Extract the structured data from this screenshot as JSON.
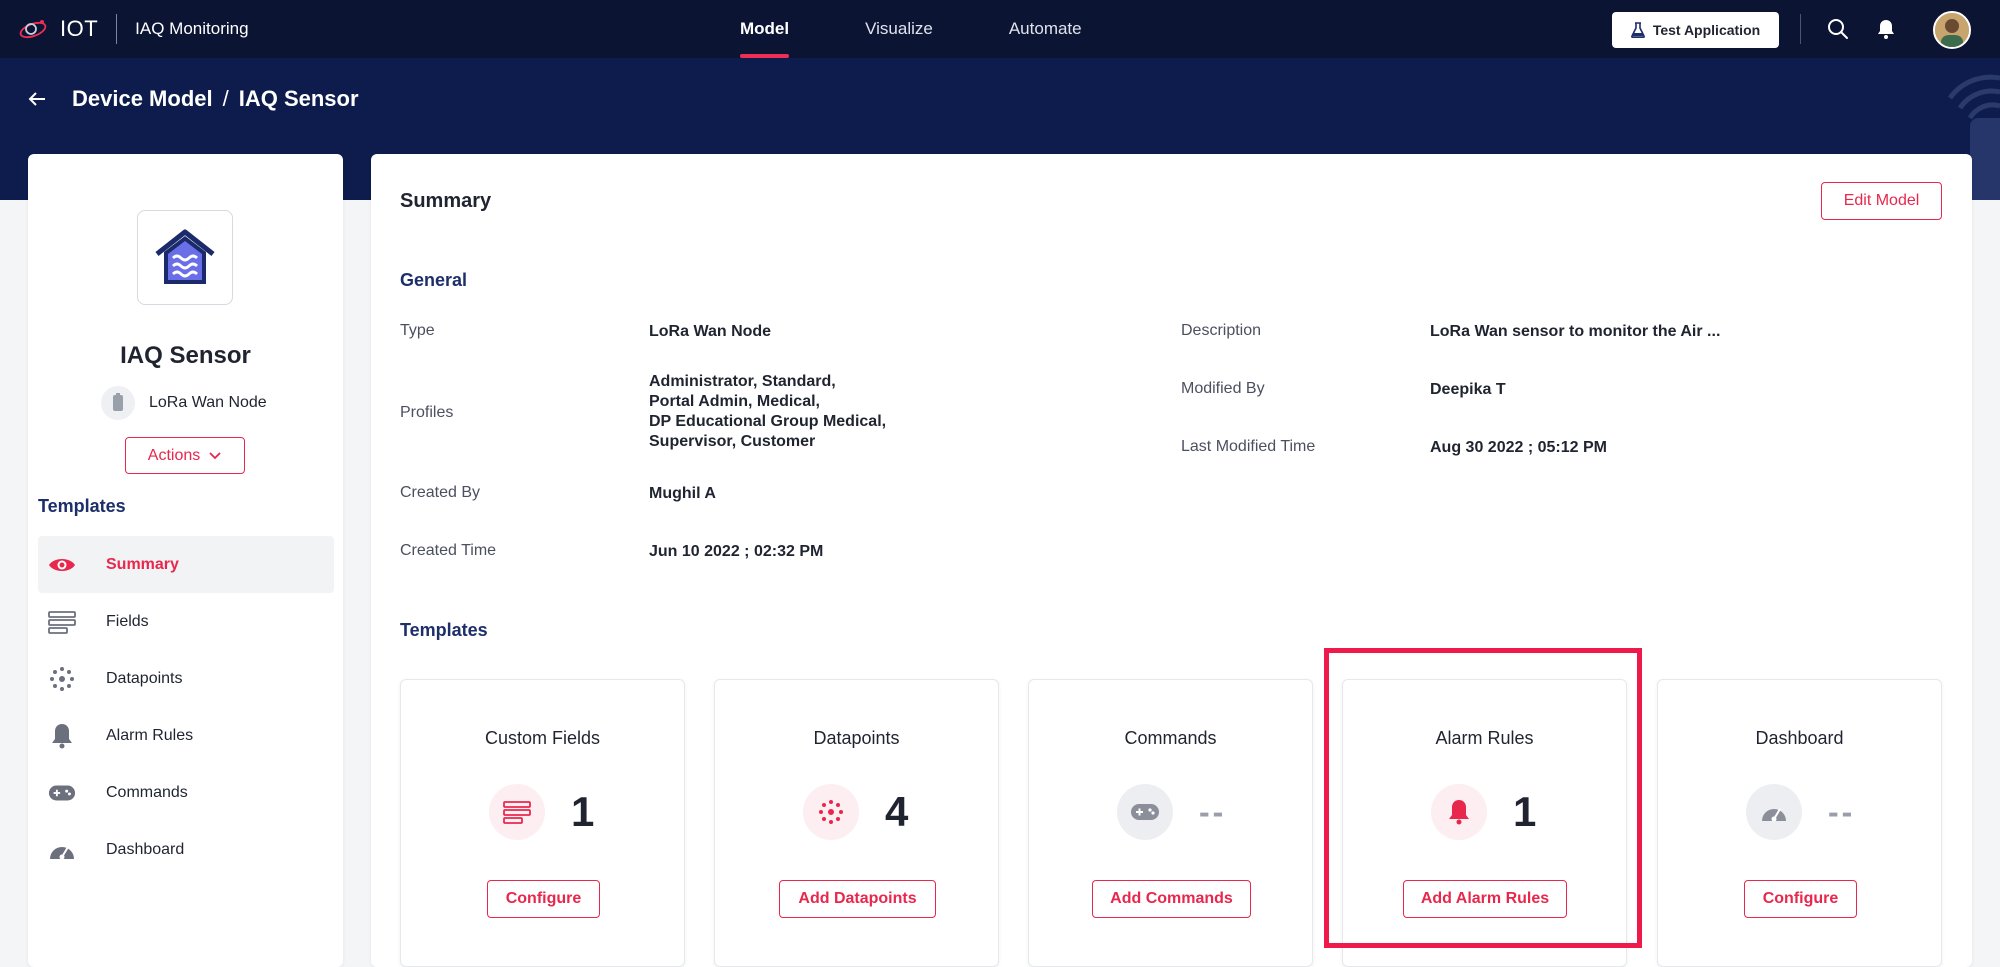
{
  "topbar": {
    "brand": "IOT",
    "app_name": "IAQ Monitoring",
    "nav": [
      "Model",
      "Visualize",
      "Automate"
    ],
    "active_nav": "Model",
    "test_app_label": "Test Application"
  },
  "header": {
    "breadcrumb": [
      "Device Model",
      "IAQ Sensor"
    ],
    "separator": "/"
  },
  "device": {
    "name": "IAQ Sensor",
    "type": "LoRa Wan Node",
    "actions_label": "Actions"
  },
  "sidebar": {
    "heading": "Templates",
    "items": [
      {
        "label": "Summary",
        "icon": "eye-icon",
        "active": true
      },
      {
        "label": "Fields",
        "icon": "fields-icon",
        "active": false
      },
      {
        "label": "Datapoints",
        "icon": "datapoints-icon",
        "active": false
      },
      {
        "label": "Alarm Rules",
        "icon": "bell-icon",
        "active": false
      },
      {
        "label": "Commands",
        "icon": "gamepad-icon",
        "active": false
      },
      {
        "label": "Dashboard",
        "icon": "gauge-icon",
        "active": false
      }
    ]
  },
  "summary": {
    "title": "Summary",
    "edit_label": "Edit Model",
    "general_heading": "General",
    "fields": {
      "type_label": "Type",
      "type_value": "LoRa Wan Node",
      "profiles_label": "Profiles",
      "profiles_lines": [
        "Administrator,  Standard,",
        "Portal Admin,  Medical,",
        "DP Educational Group Medical,",
        "Supervisor,  Customer"
      ],
      "created_by_label": "Created By",
      "created_by_value": "Mughil A",
      "created_time_label": "Created Time",
      "created_time_value": "Jun 10 2022 ; 02:32 PM",
      "description_label": "Description",
      "description_value": "LoRa Wan sensor to monitor the Air ...",
      "modified_by_label": "Modified By",
      "modified_by_value": "Deepika T",
      "last_modified_label": "Last Modified Time",
      "last_modified_value": "Aug 30 2022 ; 05:12 PM"
    },
    "templates_heading": "Templates",
    "cards": [
      {
        "title": "Custom Fields",
        "count": "1",
        "button": "Configure",
        "icon": "fields-icon",
        "active": true
      },
      {
        "title": "Datapoints",
        "count": "4",
        "button": "Add Datapoints",
        "icon": "datapoints-icon",
        "active": true
      },
      {
        "title": "Commands",
        "count": "--",
        "button": "Add Commands",
        "icon": "gamepad-icon",
        "active": false
      },
      {
        "title": "Alarm Rules",
        "count": "1",
        "button": "Add Alarm Rules",
        "icon": "bell-icon",
        "active": true
      },
      {
        "title": "Dashboard",
        "count": "--",
        "button": "Configure",
        "icon": "gauge-icon",
        "active": false
      }
    ]
  },
  "colors": {
    "accent": "#e8274d",
    "nav_bg": "#0b1533",
    "band_bg": "#0d1c4c",
    "heading_blue": "#1d2f6a",
    "highlight": "#ee1a4c"
  }
}
